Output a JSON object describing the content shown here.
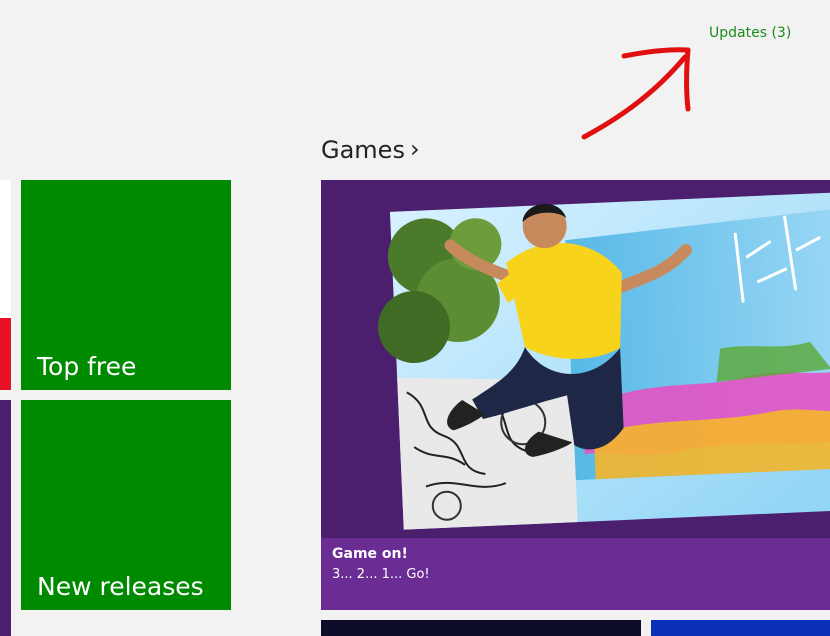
{
  "updates": {
    "label": "Updates (3)"
  },
  "section": {
    "title": "Games",
    "chevron": "›"
  },
  "tiles": {
    "top_free": "Top free",
    "new_releases": "New releases"
  },
  "hero": {
    "title": "Game on!",
    "subtitle": "3... 2... 1... Go!"
  },
  "colors": {
    "tile_green": "#008a00",
    "hero_purple": "#4c1f6e",
    "caption_purple": "#6b2c94",
    "updates_green": "#1e8a1e",
    "annotation_red": "#e01010"
  }
}
